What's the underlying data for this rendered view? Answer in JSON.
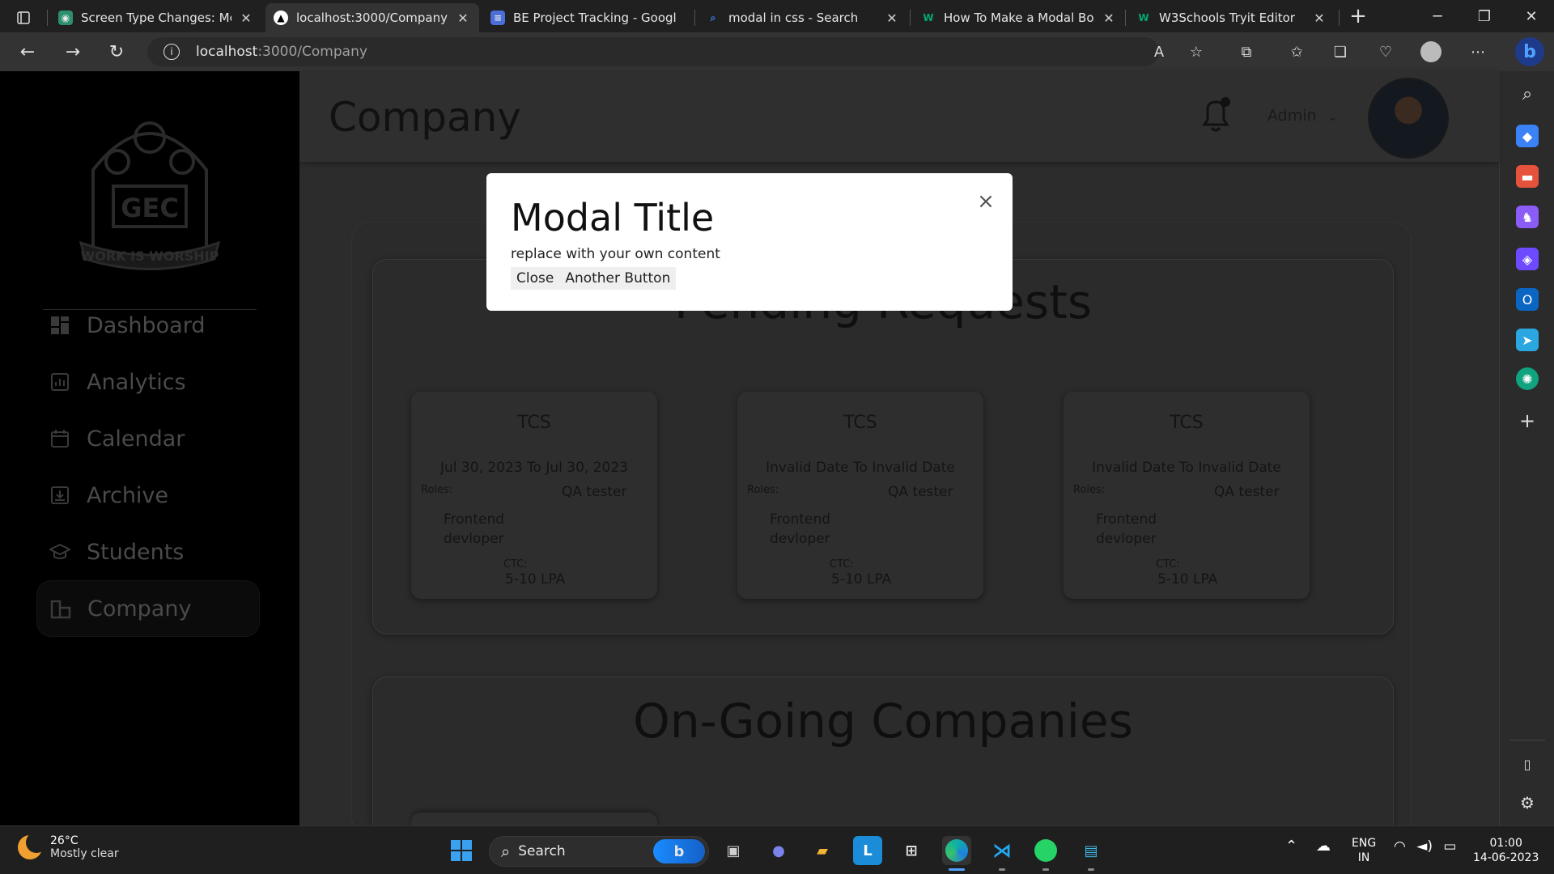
{
  "browser": {
    "tabs": [
      {
        "title": "Screen Type Changes: Medi",
        "active": false,
        "favicon": "globe-icon"
      },
      {
        "title": "localhost:3000/Company",
        "active": true,
        "favicon": "triangle-icon"
      },
      {
        "title": "BE Project Tracking - Googl",
        "active": false,
        "favicon": "docs-icon"
      },
      {
        "title": "modal in css - Search",
        "active": false,
        "favicon": "search-icon"
      },
      {
        "title": "How To Make a Modal Box",
        "active": false,
        "favicon": "w3schools-icon"
      },
      {
        "title": "W3Schools Tryit Editor",
        "active": false,
        "favicon": "w3schools-icon"
      }
    ],
    "url_host": "localhost",
    "url_path": ":3000/Company"
  },
  "app": {
    "sidebar": {
      "items": [
        {
          "label": "Dashboard",
          "icon": "dashboard-icon",
          "active": false
        },
        {
          "label": "Analytics",
          "icon": "analytics-icon",
          "active": false
        },
        {
          "label": "Calendar",
          "icon": "calendar-icon",
          "active": false
        },
        {
          "label": "Archive",
          "icon": "archive-icon",
          "active": false
        },
        {
          "label": "Students",
          "icon": "students-icon",
          "active": false
        },
        {
          "label": "Company",
          "icon": "company-icon",
          "active": true
        }
      ]
    },
    "header": {
      "title": "Company",
      "user": "Admin"
    },
    "pending": {
      "title": "Pending Requests",
      "cards": [
        {
          "company": "TCS",
          "dates": "Jul 30, 2023 To Jul 30, 2023",
          "roles_label": "Roles:",
          "role1": "QA tester",
          "role2": "Frontend devloper",
          "ctc_label": "CTC:",
          "ctc": "5-10 LPA"
        },
        {
          "company": "TCS",
          "dates": "Invalid Date To Invalid Date",
          "roles_label": "Roles:",
          "role1": "QA tester",
          "role2": "Frontend devloper",
          "ctc_label": "CTC:",
          "ctc": "5-10 LPA"
        },
        {
          "company": "TCS",
          "dates": "Invalid Date To Invalid Date",
          "roles_label": "Roles:",
          "role1": "QA tester",
          "role2": "Frontend devloper",
          "ctc_label": "CTC:",
          "ctc": "5-10 LPA"
        }
      ]
    },
    "ongoing": {
      "title": "On-Going Companies"
    }
  },
  "modal": {
    "title": "Modal Title",
    "text": "replace with your own content",
    "close_label": "Close",
    "another_label": "Another Button",
    "close_icon": "×"
  },
  "taskbar": {
    "weather_temp": "26°C",
    "weather_desc": "Mostly clear",
    "search_label": "Search",
    "lang_top": "ENG",
    "lang_bottom": "IN",
    "time": "01:00",
    "date": "14-06-2023"
  },
  "colors": {
    "accent_blue": "#1a8cff",
    "sidebar_bg": "#000000",
    "modal_bg": "#ffffff"
  }
}
